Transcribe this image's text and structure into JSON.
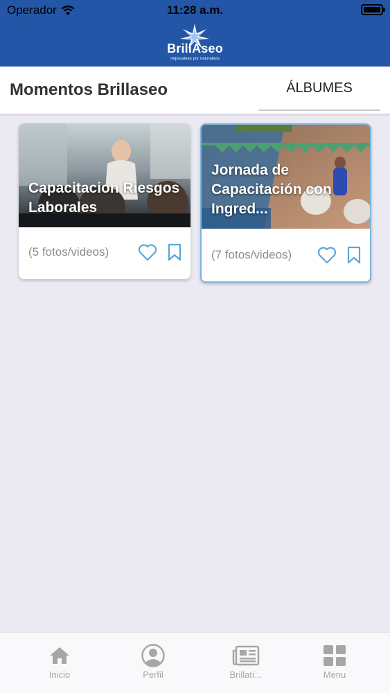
{
  "status_bar": {
    "carrier": "Operador",
    "time": "11:28 a.m."
  },
  "header": {
    "logo_text": "BrillAseo",
    "logo_tagline": "Impecables por naturaleza",
    "bg_color": "#2356a6"
  },
  "titlebar": {
    "title": "Momentos Brillaseo",
    "tab_label": "ÁLBUMES"
  },
  "albums": [
    {
      "title": "Capacitacion Riesgos Laborales",
      "count": "(5 fotos/videos)"
    },
    {
      "title": "Jornada de Capacitación con Ingred...",
      "count": "(7 fotos/videos)"
    }
  ],
  "tabbar": {
    "items": [
      {
        "label": "Inicio",
        "icon": "home-icon"
      },
      {
        "label": "Perfil",
        "icon": "profile-icon"
      },
      {
        "label": "Brillatí...",
        "icon": "newspaper-icon"
      },
      {
        "label": "Menu",
        "icon": "grid-icon"
      }
    ]
  },
  "colors": {
    "accent": "#5aa6d8",
    "inactive_tab": "#a6a6a6"
  }
}
